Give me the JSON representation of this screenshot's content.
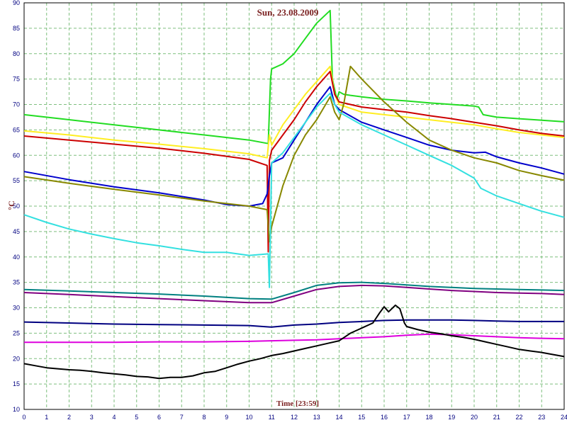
{
  "chart_data": {
    "type": "line",
    "title": "Sun, 23.08.2009",
    "xlabel": "Time [23:59]",
    "ylabel": "°C",
    "xlim": [
      0,
      24
    ],
    "ylim": [
      10,
      90
    ],
    "xticks": [
      0,
      1,
      2,
      3,
      4,
      5,
      6,
      7,
      8,
      9,
      10,
      11,
      12,
      13,
      14,
      15,
      16,
      17,
      18,
      19,
      20,
      21,
      22,
      23,
      24
    ],
    "yticks": [
      10,
      15,
      20,
      25,
      30,
      35,
      40,
      45,
      50,
      55,
      60,
      65,
      70,
      75,
      80,
      85,
      90
    ],
    "grid": true,
    "background": "#ffffff",
    "grid_color": "#7fbf7f",
    "series": [
      {
        "color": "#22dd22",
        "x": [
          0,
          2,
          4,
          6,
          8,
          10,
          10.85,
          10.95,
          11.0,
          11.5,
          12.0,
          12.5,
          13.0,
          13.6,
          13.7,
          13.9,
          14.0,
          14.2,
          14.5,
          15,
          16,
          17,
          18,
          19,
          20,
          20.2,
          20.4,
          21,
          22,
          23,
          24
        ],
        "y": [
          68,
          67,
          66,
          65,
          64,
          63,
          62.3,
          75,
          77,
          78,
          80,
          83,
          86,
          88.5,
          75,
          71,
          72.5,
          72,
          71.8,
          71.5,
          71,
          70.7,
          70.3,
          70,
          69.7,
          69.5,
          68,
          67.5,
          67.2,
          66.9,
          66.6
        ]
      },
      {
        "color": "#ffee22",
        "x": [
          0,
          2,
          4,
          6,
          8,
          10,
          10.8,
          10.9,
          11.0,
          11.5,
          12.0,
          12.5,
          13.0,
          13.6,
          13.8,
          14.0,
          15,
          16,
          17,
          18,
          19,
          20,
          21,
          22,
          23,
          24
        ],
        "y": [
          64.8,
          64,
          63,
          62.2,
          61.3,
          60.3,
          59.5,
          64,
          62,
          66,
          69,
          72,
          74.5,
          77.5,
          72,
          70,
          68.5,
          68,
          67.5,
          67,
          66.5,
          66,
          65.2,
          64.5,
          64,
          63.5
        ]
      },
      {
        "color": "#cc0000",
        "x": [
          0,
          2,
          4,
          6,
          8,
          10,
          10.8,
          10.85,
          10.9,
          11.0,
          11.5,
          12.0,
          12.5,
          13.0,
          13.6,
          13.8,
          14.0,
          15,
          16,
          17,
          18,
          19,
          20,
          21,
          22,
          23,
          24
        ],
        "y": [
          63.8,
          63,
          62.2,
          61.4,
          60.4,
          59.2,
          58,
          41,
          59,
          61,
          64,
          67,
          70.5,
          73.5,
          76.5,
          72,
          70.5,
          69.5,
          69,
          68.5,
          67.8,
          67.2,
          66.5,
          65.8,
          65,
          64.3,
          63.8
        ]
      },
      {
        "color": "#0000cc",
        "x": [
          0,
          2,
          4,
          6,
          8,
          9,
          10,
          10.6,
          10.8,
          10.9,
          11.0,
          11.5,
          12.0,
          12.5,
          13.0,
          13.6,
          13.8,
          14.0,
          15,
          16,
          17,
          18,
          19,
          20,
          20.5,
          21,
          22,
          23,
          24
        ],
        "y": [
          56.8,
          55.2,
          53.8,
          52.6,
          51.2,
          50.3,
          50.0,
          50.5,
          52.4,
          56,
          58.5,
          59.5,
          63,
          66.5,
          70,
          73.5,
          70,
          69,
          66.5,
          65,
          63.5,
          62,
          61,
          60.5,
          60.6,
          59.7,
          58.5,
          57.5,
          56.3
        ]
      },
      {
        "color": "#888800",
        "x": [
          0,
          2,
          4,
          6,
          8,
          10,
          10.8,
          10.9,
          11.0,
          11.5,
          12.0,
          12.5,
          13.0,
          13.6,
          13.8,
          14.0,
          14.2,
          14.5,
          15,
          16,
          17,
          18,
          19,
          20,
          21,
          22,
          23,
          24
        ],
        "y": [
          55.8,
          54.5,
          53.3,
          52.2,
          51,
          50,
          49.3,
          43,
          46,
          54,
          60,
          64,
          67,
          71.5,
          68.5,
          67,
          70,
          77.5,
          75,
          70.5,
          66.5,
          63,
          61,
          59.5,
          58.5,
          57,
          56,
          55.1
        ]
      },
      {
        "color": "#33e0e0",
        "x": [
          0,
          1,
          2,
          3,
          4,
          5,
          6,
          7,
          8,
          9,
          10,
          10.85,
          10.9,
          11.0,
          11.5,
          12.0,
          12.5,
          13.0,
          13.6,
          13.8,
          14.0,
          15,
          16,
          17,
          18,
          19,
          20,
          20.3,
          21,
          22,
          23,
          24
        ],
        "y": [
          48.3,
          46.8,
          45.5,
          44.5,
          43.6,
          42.8,
          42.2,
          41.5,
          40.9,
          40.9,
          40.3,
          40.6,
          34,
          58.5,
          60.5,
          63.5,
          66.5,
          69.5,
          72.2,
          70,
          68.5,
          66,
          64,
          62,
          60,
          58,
          55.5,
          53.5,
          52,
          50.5,
          49,
          47.8
        ]
      },
      {
        "color": "#008080",
        "x": [
          0,
          2,
          4,
          6,
          8,
          10,
          11,
          12,
          13,
          14,
          15,
          16,
          17,
          18,
          19,
          20,
          21,
          22,
          23,
          24
        ],
        "y": [
          33.6,
          33.3,
          33.0,
          32.7,
          32.3,
          31.8,
          31.7,
          33,
          34.4,
          34.9,
          35.0,
          34.8,
          34.5,
          34.2,
          34,
          33.8,
          33.7,
          33.6,
          33.5,
          33.4
        ]
      },
      {
        "color": "#800080",
        "x": [
          0,
          2,
          4,
          6,
          8,
          10,
          11,
          12,
          13,
          14,
          15,
          16,
          17,
          18,
          19,
          20,
          21,
          22,
          23,
          24
        ],
        "y": [
          33.0,
          32.6,
          32.2,
          31.8,
          31.4,
          31.0,
          31.0,
          32.3,
          33.6,
          34.2,
          34.4,
          34.3,
          34.0,
          33.7,
          33.4,
          33.2,
          33.0,
          32.9,
          32.8,
          32.6
        ]
      },
      {
        "color": "#000080",
        "x": [
          0,
          2,
          4,
          6,
          8,
          10,
          11,
          12,
          13,
          14,
          15,
          16,
          17,
          18,
          19,
          20,
          21,
          22,
          23,
          24
        ],
        "y": [
          27.2,
          27.0,
          26.8,
          26.7,
          26.6,
          26.5,
          26.2,
          26.6,
          26.8,
          27.1,
          27.3,
          27.5,
          27.6,
          27.6,
          27.6,
          27.5,
          27.4,
          27.3,
          27.3,
          27.3
        ]
      },
      {
        "color": "#dd00dd",
        "x": [
          0,
          2,
          4,
          6,
          8,
          10,
          11,
          12,
          13,
          14,
          15,
          16,
          17,
          18,
          19,
          20,
          21,
          22,
          23,
          24
        ],
        "y": [
          23.2,
          23.2,
          23.2,
          23.3,
          23.3,
          23.4,
          23.5,
          23.6,
          23.7,
          23.9,
          24.1,
          24.3,
          24.6,
          24.8,
          24.7,
          24.5,
          24.3,
          24.1,
          24.0,
          23.9
        ]
      },
      {
        "color": "#000000",
        "x": [
          0,
          0.5,
          1,
          1.5,
          2,
          2.5,
          3,
          3.5,
          4,
          4.5,
          5,
          5.5,
          6,
          6.5,
          7,
          7.5,
          8,
          8.5,
          9,
          9.5,
          10,
          10.5,
          11,
          11.5,
          12,
          12.5,
          13,
          13.5,
          14,
          14.5,
          15,
          15.5,
          15.8,
          16.0,
          16.2,
          16.5,
          16.7,
          16.9,
          17.0,
          17.5,
          18,
          18.5,
          19,
          19.5,
          20,
          20.5,
          21,
          21.5,
          22,
          22.5,
          23,
          23.5,
          24
        ],
        "y": [
          19,
          18.6,
          18.2,
          18.0,
          17.8,
          17.7,
          17.5,
          17.2,
          17.0,
          16.8,
          16.5,
          16.4,
          16.1,
          16.3,
          16.3,
          16.6,
          17.2,
          17.5,
          18.2,
          18.9,
          19.5,
          20.0,
          20.6,
          21.0,
          21.5,
          22.0,
          22.5,
          23.0,
          23.5,
          25.0,
          26.0,
          27.0,
          29.0,
          30.2,
          29.2,
          30.5,
          29.8,
          27.0,
          26.3,
          25.7,
          25.2,
          24.9,
          24.5,
          24.2,
          23.8,
          23.3,
          22.8,
          22.3,
          21.8,
          21.5,
          21.2,
          20.8,
          20.4
        ]
      }
    ]
  }
}
